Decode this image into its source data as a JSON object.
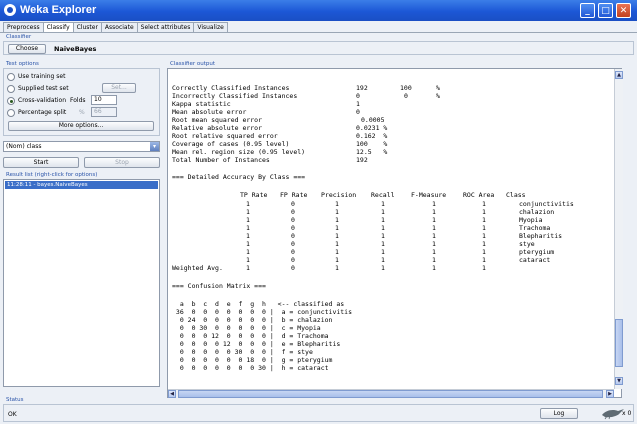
{
  "window": {
    "title": "Weka Explorer",
    "minimize": "_",
    "maximize": "□",
    "close": "✕"
  },
  "tabs": [
    "Preprocess",
    "Classify",
    "Cluster",
    "Associate",
    "Select attributes",
    "Visualize"
  ],
  "classifier": {
    "section": "Classifier",
    "choose_label": "Choose",
    "name": "NaiveBayes"
  },
  "test_options": {
    "section": "Test options",
    "use_training": "Use training set",
    "supplied_test": "Supplied test set",
    "set_label": "Set...",
    "cross_validation": "Cross-validation",
    "folds_label": "Folds",
    "folds_value": "10",
    "percentage_split": "Percentage split",
    "pct_label": "%",
    "pct_value": "66",
    "more_options": "More options..."
  },
  "class_select": "(Nom) class",
  "start_label": "Start",
  "stop_label": "Stop",
  "result_list": {
    "section": "Result list (right-click for options)",
    "items": [
      "11:28:11 - bayes.NaiveBayes"
    ]
  },
  "output": {
    "section": "Classifier output",
    "summary": [
      [
        "Correctly Classified Instances",
        "192",
        "100",
        "%"
      ],
      [
        "Incorrectly Classified Instances",
        "0",
        "0",
        "%"
      ],
      [
        "Kappa statistic",
        "1",
        "",
        ""
      ],
      [
        "Mean absolute error",
        "0",
        "",
        ""
      ],
      [
        "Root mean squared error",
        "0.0005",
        "",
        ""
      ],
      [
        "Relative absolute error",
        "0.0231 %",
        "",
        ""
      ],
      [
        "Root relative squared error",
        "0.162  %",
        "",
        ""
      ],
      [
        "Coverage of cases (0.95 level)",
        "100    %",
        "",
        ""
      ],
      [
        "Mean rel. region size (0.95 level)",
        "12.5   %",
        "",
        ""
      ],
      [
        "Total Number of Instances",
        "192",
        "",
        ""
      ]
    ],
    "accuracy_header": "=== Detailed Accuracy By Class ===",
    "acc_columns": [
      "TP Rate",
      "FP Rate",
      "Precision",
      "Recall",
      "F-Measure",
      "ROC Area",
      "Class"
    ],
    "acc_rows": [
      [
        "1",
        "0",
        "1",
        "1",
        "1",
        "1",
        "conjunctivitis"
      ],
      [
        "1",
        "0",
        "1",
        "1",
        "1",
        "1",
        "chalazion"
      ],
      [
        "1",
        "0",
        "1",
        "1",
        "1",
        "1",
        "Myopia"
      ],
      [
        "1",
        "0",
        "1",
        "1",
        "1",
        "1",
        "Trachoma"
      ],
      [
        "1",
        "0",
        "1",
        "1",
        "1",
        "1",
        "Blepharitis"
      ],
      [
        "1",
        "0",
        "1",
        "1",
        "1",
        "1",
        "stye"
      ],
      [
        "1",
        "0",
        "1",
        "1",
        "1",
        "1",
        "pterygium"
      ],
      [
        "1",
        "0",
        "1",
        "1",
        "1",
        "1",
        "cataract"
      ]
    ],
    "weighted_avg": [
      "Weighted Avg.",
      "1",
      "0",
      "1",
      "1",
      "1",
      "1"
    ],
    "confusion_header": "=== Confusion Matrix ===",
    "confusion_lines": [
      "  a  b  c  d  e  f  g  h   <-- classified as",
      " 36  0  0  0  0  0  0  0 |  a = conjunctivitis",
      "  0 24  0  0  0  0  0  0 |  b = chalazion",
      "  0  0 30  0  0  0  0  0 |  c = Myopia",
      "  0  0  0 12  0  0  0  0 |  d = Trachoma",
      "  0  0  0  0 12  0  0  0 |  e = Blepharitis",
      "  0  0  0  0  0 30  0  0 |  f = stye",
      "  0  0  0  0  0  0 18  0 |  g = pterygium",
      "  0  0  0  0  0  0  0 30 |  h = cataract"
    ]
  },
  "status": {
    "section": "Status",
    "text": "OK",
    "log_label": "Log",
    "x_count": "x 0"
  }
}
